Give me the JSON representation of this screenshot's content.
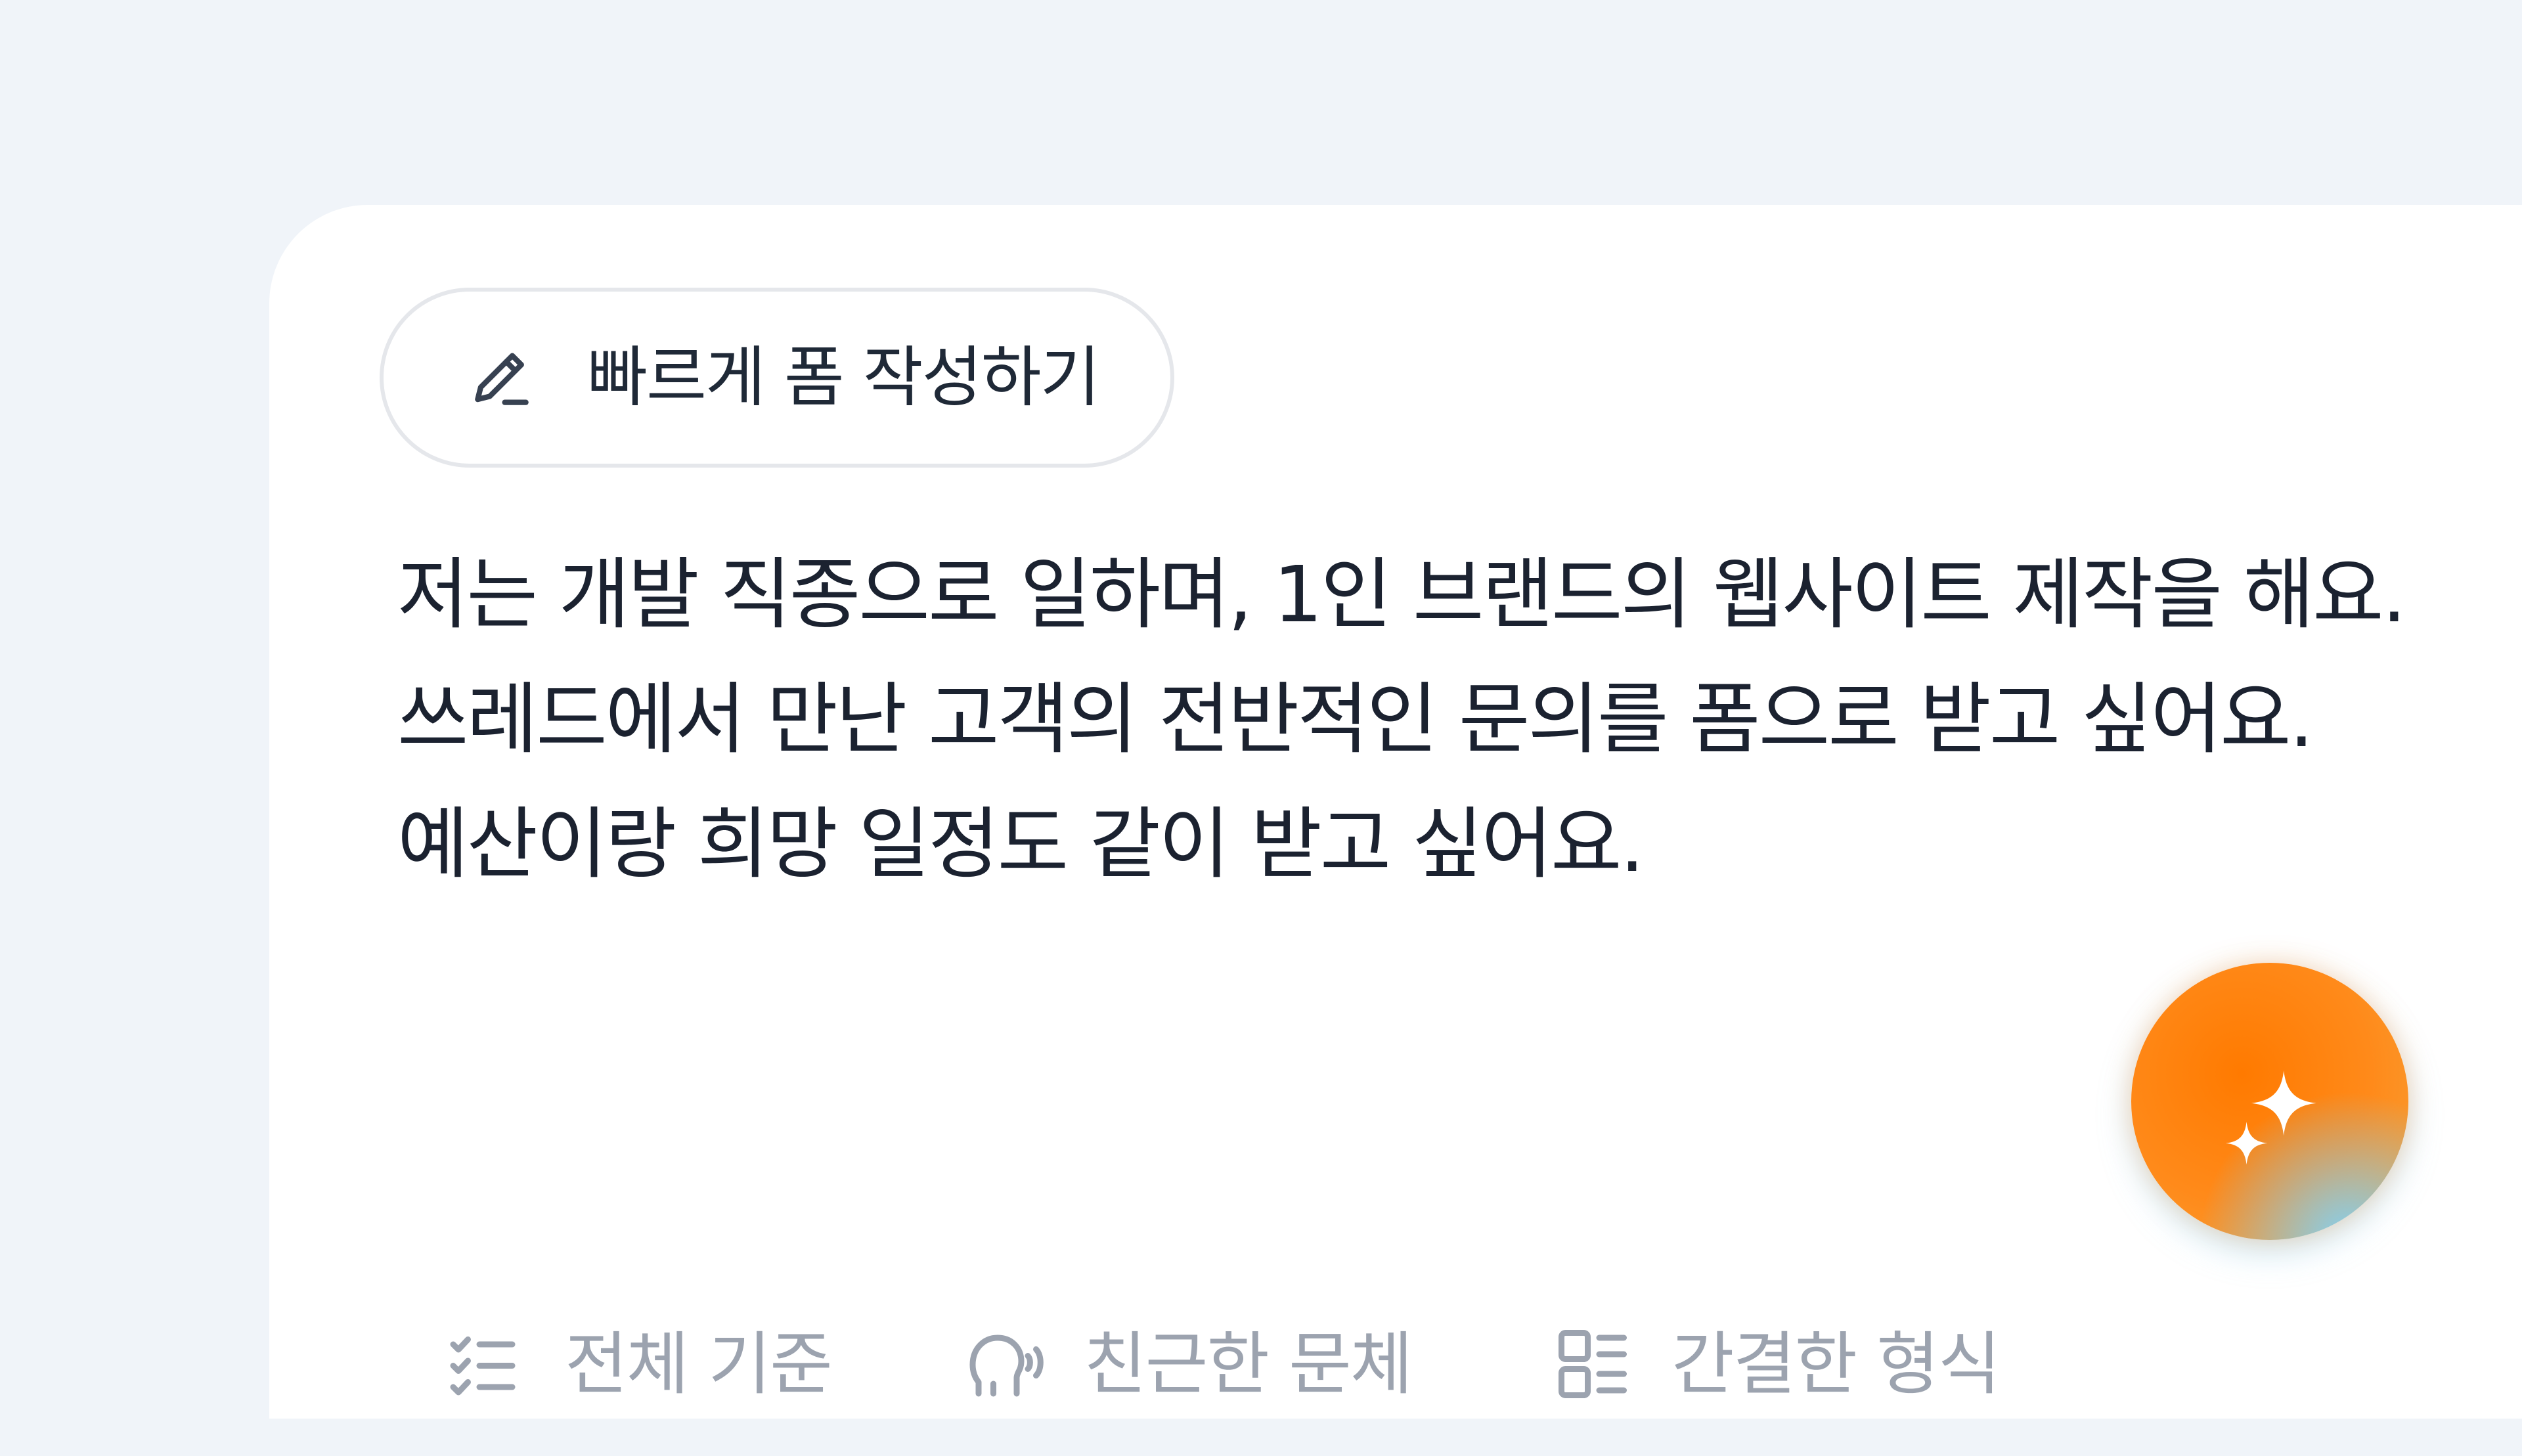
{
  "quick_form": {
    "label": "빠르게 폼 작성하기",
    "icon": "pencil-icon"
  },
  "prompt": {
    "lines": [
      "저는 개발 직종으로 일하며, 1인 브랜드의 웹사이트 제작을 해요.",
      "쓰레드에서 만난 고객의 전반적인 문의를 폼으로 받고 싶어요.",
      "예산이랑 희망 일정도 같이 받고 싶어요."
    ]
  },
  "options": [
    {
      "label": "전체 기준",
      "icon": "checklist-icon"
    },
    {
      "label": "친근한 문체",
      "icon": "voice-icon"
    },
    {
      "label": "간결한 형식",
      "icon": "layout-list-icon"
    }
  ],
  "fab": {
    "icon": "sparkle-icon"
  },
  "colors": {
    "background": "#f0f4f9",
    "card": "#ffffff",
    "text_primary": "#1b2230",
    "text_muted": "#9ca3af",
    "accent_orange": "#ff7a00",
    "accent_cyan": "#7dd3fc"
  }
}
